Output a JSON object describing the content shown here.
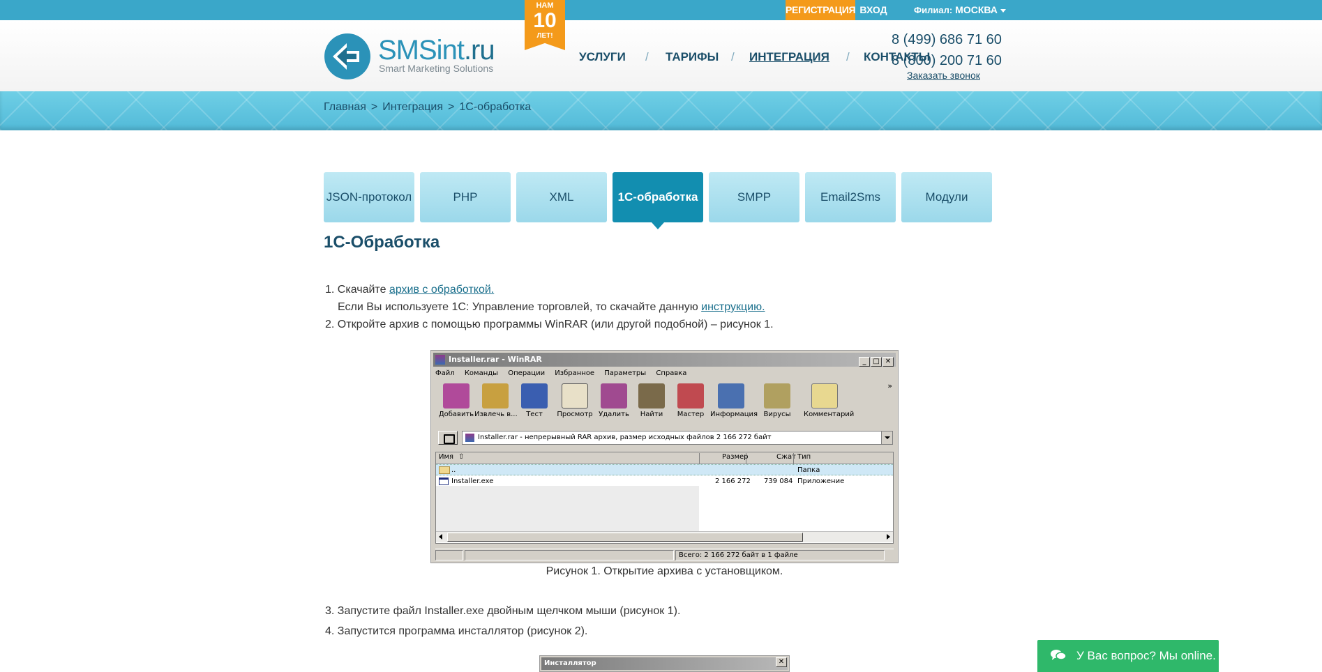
{
  "topbar": {
    "register": "РЕГИСТРАЦИЯ",
    "login": "ВХОД",
    "branch_label": "Филиал:",
    "branch_city": "МОСКВА"
  },
  "header": {
    "logo_name_main": "SMSint",
    "logo_name_tld": ".ru",
    "logo_subtitle": "Smart Marketing Solutions",
    "badge_top": "НАМ",
    "badge_number": "10",
    "badge_bottom": "ЛЕТ!",
    "nav": [
      {
        "label": "УСЛУГИ"
      },
      {
        "label": "ТАРИФЫ"
      },
      {
        "label": "ИНТЕГРАЦИЯ",
        "active": true
      },
      {
        "label": "КОНТАКТЫ"
      }
    ],
    "phone1": "8 (499) 686 71 60",
    "phone2": "8 (800) 200 71 60",
    "callback": "Заказать звонок"
  },
  "breadcrumb": {
    "items": [
      "Главная",
      "Интеграция",
      "1С-обработка"
    ],
    "separator": ">"
  },
  "tabs": [
    {
      "label": "JSON-протокол"
    },
    {
      "label": "PHP"
    },
    {
      "label": "XML"
    },
    {
      "label": "1С-обработка",
      "active": true
    },
    {
      "label": "SMPP"
    },
    {
      "label": "Email2Sms"
    },
    {
      "label": "Модули"
    }
  ],
  "page": {
    "title": "1С-Обработка",
    "step1_num": "1.",
    "step1_text": "Скачайте ",
    "step1_link": "архив с обработкой.",
    "step1_note": "Если Вы используете 1С: Управление торговлей, то скачайте данную ",
    "step1_note_link": "инструкцию.",
    "step2": "2. Откройте архив с помощью программы WinRAR (или другой подобной) – рисунок 1.",
    "caption1": "Рисунок 1. Открытие архива с установщиком.",
    "step3": "3. Запустите файл Installer.exe двойным щелчком мыши (рисунок 1).",
    "step4": "4. Запустится программа инсталлятор (рисунок 2)."
  },
  "winrar": {
    "title": "Installer.rar - WinRAR",
    "menu": [
      "Файл",
      "Команды",
      "Операции",
      "Избранное",
      "Параметры",
      "Справка"
    ],
    "toolbar": [
      {
        "label": "Добавить",
        "color": "#b04a9a"
      },
      {
        "label": "Извлечь в...",
        "color": "#c8a040"
      },
      {
        "label": "Тест",
        "color": "#3a5eb0"
      },
      {
        "label": "Просмотр",
        "color": "#e8e0c8"
      },
      {
        "label": "Удалить",
        "color": "#a04a90"
      },
      {
        "label": "Найти",
        "color": "#7a6a4a"
      },
      {
        "label": "Мастер",
        "color": "#c04a50"
      },
      {
        "label": "Информация",
        "color": "#4a70b0"
      },
      {
        "label": "Вирусы",
        "color": "#b0a060"
      },
      {
        "label": "Комментарий",
        "color": "#e8d890"
      }
    ],
    "path": "Installer.rar - непрерывный RAR архив, размер исходных файлов 2 166 272 байт",
    "columns": [
      "Имя",
      "Размер",
      "Сжат",
      "Тип"
    ],
    "rows": [
      {
        "name": "..",
        "size": "",
        "packed": "",
        "type": "Папка"
      },
      {
        "name": "Installer.exe",
        "size": "2 166 272",
        "packed": "739 084",
        "type": "Приложение"
      }
    ],
    "status": "Всего: 2 166 272 байт в 1 файле"
  },
  "installer": {
    "title": "Инсталлятор"
  },
  "chat": {
    "label": "У Вас вопрос? Мы online."
  }
}
